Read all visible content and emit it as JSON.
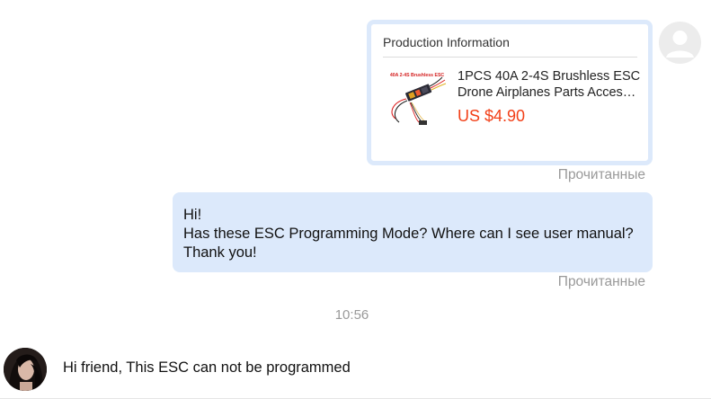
{
  "product_card": {
    "title": "Production Information",
    "product_name_line1": "1PCS 40A 2-4S Brushless ESC",
    "product_name_line2": "Drone Airplanes Parts Accessories",
    "price": "US $4.90",
    "thumbnail_caption": "40A 2-4S Brushless ESC",
    "read_status": "Прочитанные"
  },
  "sent_message": {
    "lines": [
      "Hi!",
      "Has these ESC Programming Mode? Where can I see user manual?",
      "Thank you!"
    ],
    "read_status": "Прочитанные"
  },
  "time_divider": "10:56",
  "received_message": {
    "text": "Hi friend, This ESC can not be programmed"
  },
  "colors": {
    "bubble": "#dce9fb",
    "price": "#f23f17",
    "muted_text": "#999999"
  }
}
